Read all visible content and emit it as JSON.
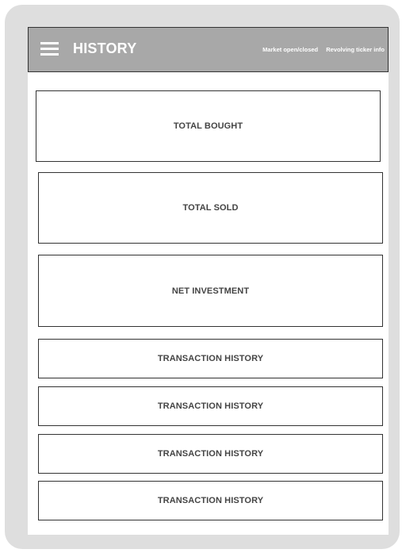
{
  "header": {
    "title": "HISTORY",
    "market_status": "Market open/closed",
    "ticker_info": "Revolving ticker info",
    "menu_icon": "hamburger-menu-icon"
  },
  "summary": {
    "total_bought_label": "TOTAL BOUGHT",
    "total_sold_label": "TOTAL SOLD",
    "net_investment_label": "NET INVESTMENT"
  },
  "transactions": [
    {
      "label": "TRANSACTION HISTORY"
    },
    {
      "label": "TRANSACTION HISTORY"
    },
    {
      "label": "TRANSACTION HISTORY"
    },
    {
      "label": "TRANSACTION HISTORY"
    }
  ],
  "colors": {
    "frame": "#dedede",
    "header_background": "#a8a8a8",
    "header_text": "#ffffff",
    "card_border": "#333333",
    "card_text": "#444444"
  }
}
